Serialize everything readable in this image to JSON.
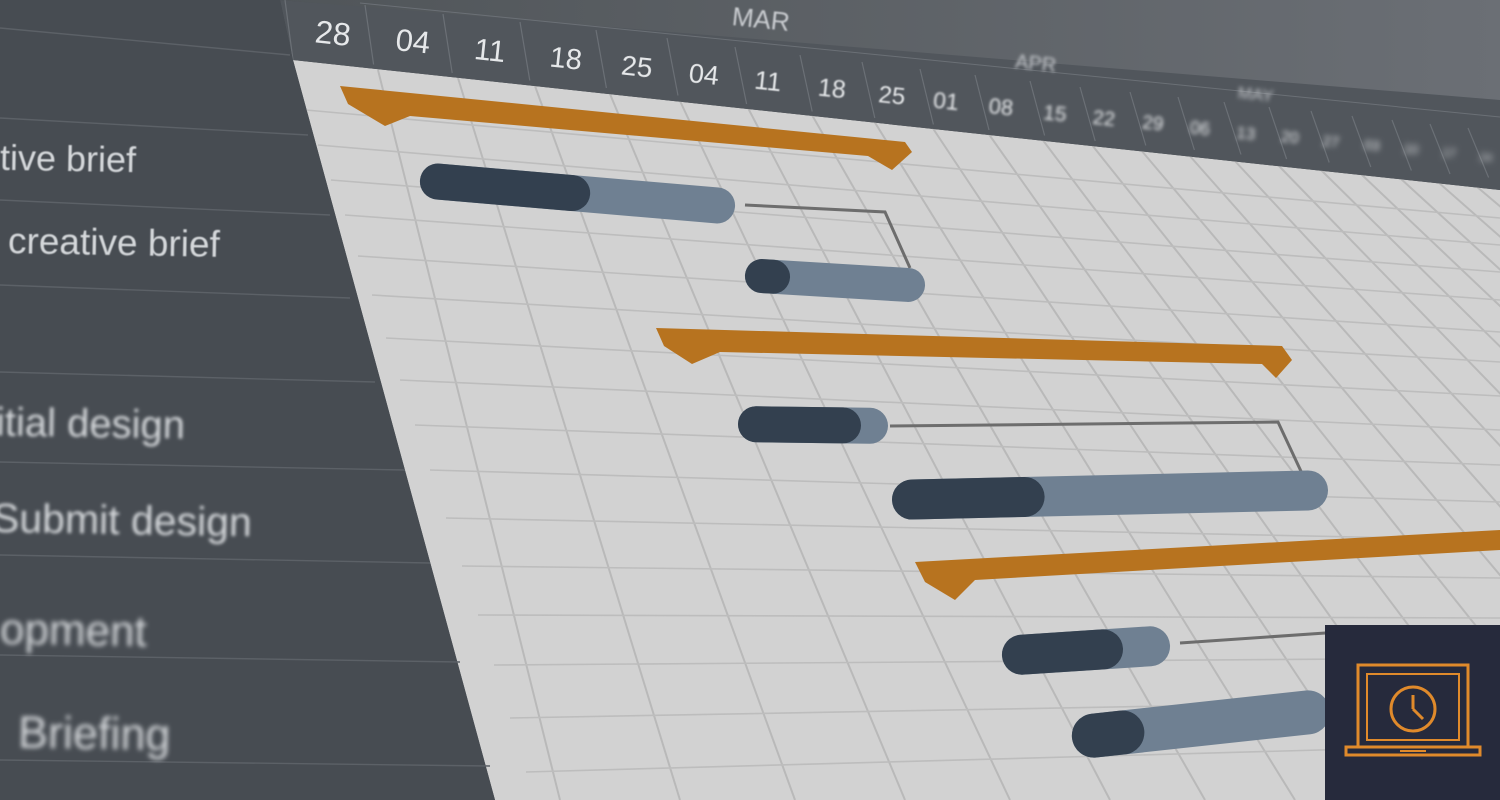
{
  "timeline": {
    "months": [
      "MAR",
      "APR",
      "MAY"
    ],
    "dates": [
      "28",
      "04",
      "11",
      "18",
      "25",
      "04",
      "11",
      "18",
      "25",
      "01",
      "08",
      "15",
      "22",
      "29",
      "06",
      "13",
      "20",
      "27",
      "03",
      "10",
      "17",
      "24"
    ]
  },
  "tasks": [
    {
      "label": "tive brief"
    },
    {
      "label": "creative brief"
    },
    {
      "label": ""
    },
    {
      "label": "itial design"
    },
    {
      "label": "Submit design"
    },
    {
      "label": "opment"
    },
    {
      "label": "Briefing"
    }
  ],
  "colors": {
    "sidebar": "#474c52",
    "header": "#51565c",
    "grid_bg": "#d2d2d2",
    "grid_line": "#b9b9b9",
    "summary_bar": "#b7731f",
    "task_done": "#33404f",
    "task_remaining": "#6f8092",
    "logo_bg": "#262a3c",
    "logo_icon": "#e08a2b"
  },
  "icons": {
    "app_logo": "laptop-clock-icon"
  }
}
